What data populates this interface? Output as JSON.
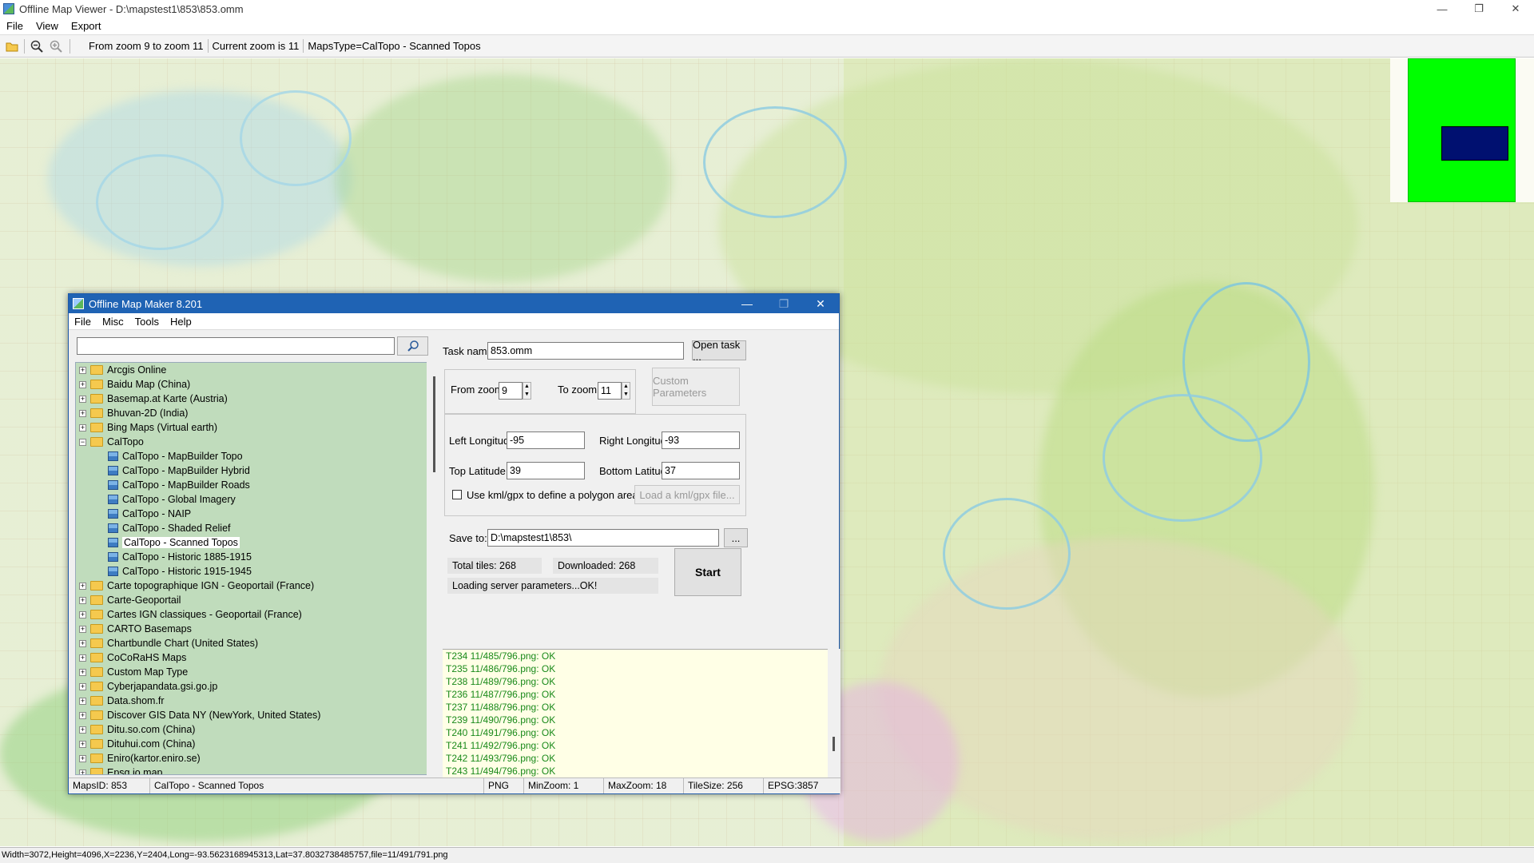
{
  "window": {
    "title": "Offline Map Viewer - D:\\mapstest1\\853\\853.omm",
    "minimize": "—",
    "maximize": "❐",
    "close": "✕"
  },
  "menu": [
    "File",
    "View",
    "Export"
  ],
  "toolbar": {
    "zoom_range": "From zoom 9 to zoom 11",
    "current_zoom": "Current zoom is 11",
    "maps_type": "MapsType=CalTopo - Scanned Topos"
  },
  "status_bar": "Width=3072,Height=4096,X=2236,Y=2404,Long=-93.5623168945313,Lat=37.8032738485757,file=11/491/791.png",
  "dialog": {
    "title": "Offline Map Maker 8.201",
    "menu": [
      "File",
      "Misc",
      "Tools",
      "Help"
    ],
    "search": {
      "value": ""
    },
    "tree": [
      {
        "label": "Arcgis Online",
        "expanded": false
      },
      {
        "label": "Baidu Map (China)",
        "expanded": false
      },
      {
        "label": "Basemap.at Karte (Austria)",
        "expanded": false
      },
      {
        "label": "Bhuvan-2D (India)",
        "expanded": false
      },
      {
        "label": "Bing Maps (Virtual earth)",
        "expanded": false
      },
      {
        "label": "CalTopo",
        "expanded": true,
        "children": [
          {
            "label": "CalTopo - MapBuilder Topo"
          },
          {
            "label": "CalTopo - MapBuilder Hybrid"
          },
          {
            "label": "CalTopo - MapBuilder Roads"
          },
          {
            "label": "CalTopo - Global Imagery"
          },
          {
            "label": "CalTopo - NAIP"
          },
          {
            "label": "CalTopo - Shaded Relief"
          },
          {
            "label": "CalTopo - Scanned Topos",
            "selected": true
          },
          {
            "label": "CalTopo - Historic 1885-1915"
          },
          {
            "label": "CalTopo - Historic 1915-1945"
          }
        ]
      },
      {
        "label": "Carte topographique IGN - Geoportail (France)",
        "expanded": false
      },
      {
        "label": "Carte-Geoportail",
        "expanded": false
      },
      {
        "label": "Cartes IGN classiques - Geoportail (France)",
        "expanded": false
      },
      {
        "label": "CARTO Basemaps",
        "expanded": false
      },
      {
        "label": "Chartbundle Chart (United States)",
        "expanded": false
      },
      {
        "label": "CoCoRaHS Maps",
        "expanded": false
      },
      {
        "label": "Custom Map Type",
        "expanded": false
      },
      {
        "label": "Cyberjapandata.gsi.go.jp",
        "expanded": false
      },
      {
        "label": "Data.shom.fr",
        "expanded": false
      },
      {
        "label": "Discover GIS Data NY (NewYork, United States)",
        "expanded": false
      },
      {
        "label": "Ditu.so.com (China)",
        "expanded": false
      },
      {
        "label": "Dituhui.com (China)",
        "expanded": false
      },
      {
        "label": "Eniro(kartor.eniro.se)",
        "expanded": false
      },
      {
        "label": "Epsg.io map",
        "expanded": false
      }
    ],
    "form": {
      "task_name_label": "Task name",
      "task_name": "853.omm",
      "open_task": "Open task ...",
      "from_zoom_label": "From zoom",
      "from_zoom": "9",
      "to_zoom_label": "To zoom",
      "to_zoom": "11",
      "custom_params": "Custom Parameters",
      "left_lon_label": "Left Longitude",
      "left_lon": "-95",
      "right_lon_label": "Right Longitude",
      "right_lon": "-93",
      "top_lat_label": "Top Latitude",
      "top_lat": "39",
      "bottom_lat_label": "Bottom Latitude",
      "bottom_lat": "37",
      "kml_label": "Use kml/gpx to define a polygon area",
      "kml_checked": false,
      "load_kml": "Load a kml/gpx file...",
      "save_to_label": "Save to:",
      "save_to": "D:\\mapstest1\\853\\",
      "browse": "...",
      "total_tiles": "Total tiles: 268",
      "downloaded": "Downloaded: 268",
      "progress": "Loading server parameters...OK!",
      "start": "Start"
    },
    "log": [
      "T234 11/485/796.png: OK",
      "T235 11/486/796.png: OK",
      "T238 11/489/796.png: OK",
      "T236 11/487/796.png: OK",
      "T237 11/488/796.png: OK",
      "T239 11/490/796.png: OK",
      "T240 11/491/796.png: OK",
      "T241 11/492/796.png: OK",
      "T242 11/493/796.png: OK",
      "T243 11/494/796.png: OK"
    ],
    "status": {
      "maps_id": "MapsID: 853",
      "map_name": "CalTopo - Scanned Topos",
      "format": "PNG",
      "min_zoom": "MinZoom: 1",
      "max_zoom": "MaxZoom: 18",
      "tile_size": "TileSize: 256",
      "epsg": "EPSG:3857"
    }
  },
  "colors": {
    "overview_green": "#00ff00",
    "overview_viewport": "#001070",
    "tree_bg": "#c0dcbc",
    "log_text": "#1a8a1a",
    "dialog_title": "#1f63b4"
  }
}
